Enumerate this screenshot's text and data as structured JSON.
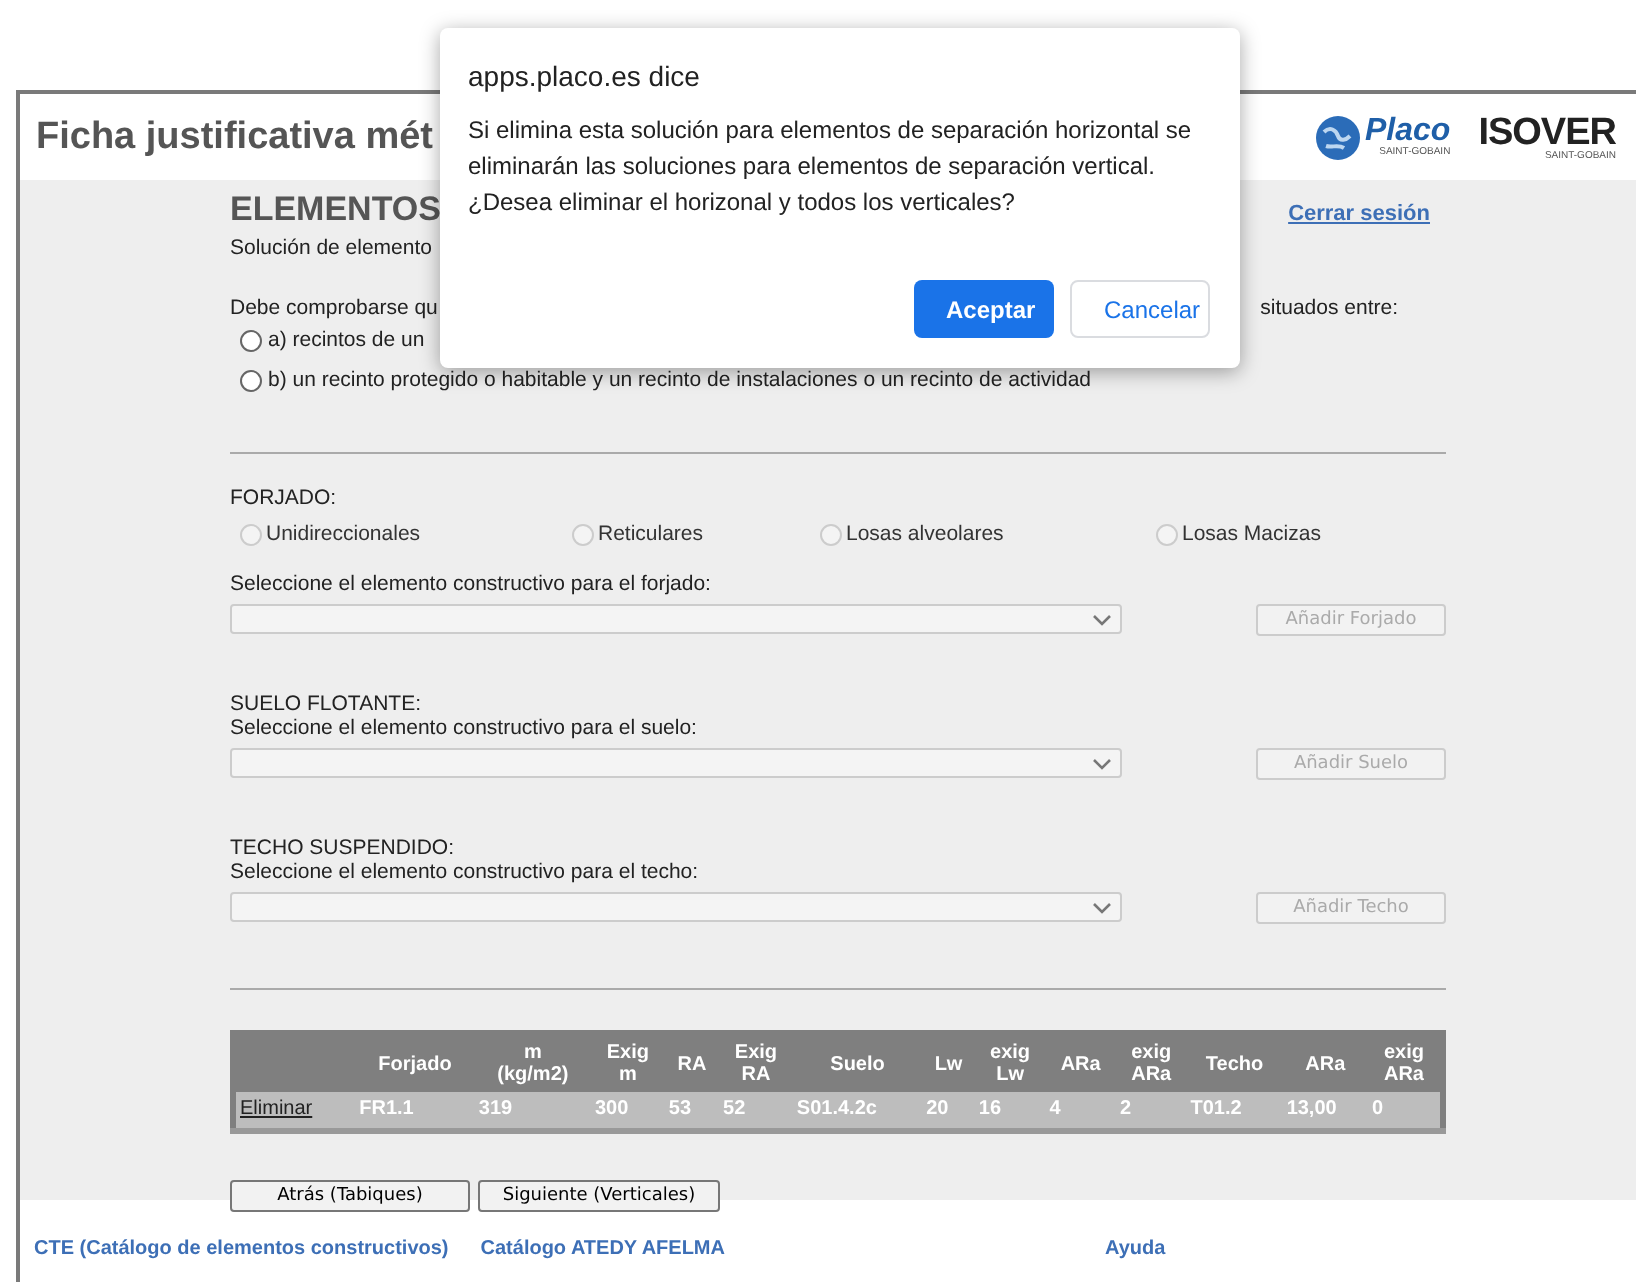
{
  "header": {
    "title": "Ficha justificativa mét",
    "logos": [
      {
        "kind": "placo",
        "name": "Placo",
        "sub": "SAINT-GOBAIN"
      },
      {
        "kind": "isover",
        "name": "ISOVER",
        "sub": "SAINT-GOBAIN"
      }
    ]
  },
  "content": {
    "heading": "ELEMENTOS",
    "logout": "Cerrar sesión",
    "subtitle": "Solución de elemento",
    "intro_left": "Debe comprobarse qu",
    "intro_right": "situados entre:",
    "options": [
      {
        "label": "a) recintos de un",
        "selected": false
      },
      {
        "label": "b) un recinto protegido o habitable y un recinto de instalaciones o un recinto de actividad",
        "selected": false
      }
    ],
    "forjado": {
      "title": "FORJADO:",
      "types": [
        {
          "label": "Unidireccionales",
          "selected": false
        },
        {
          "label": "Reticulares",
          "selected": false
        },
        {
          "label": "Losas alveolares",
          "selected": false
        },
        {
          "label": "Losas Macizas",
          "selected": false
        }
      ],
      "prompt": "Seleccione el elemento constructivo para el forjado:",
      "button": "Añadir Forjado",
      "disabled": true
    },
    "sections": [
      {
        "title": "SUELO FLOTANTE:",
        "prompt": "Seleccione el elemento constructivo para el suelo:",
        "button": "Añadir Suelo",
        "disabled": true
      },
      {
        "title": "TECHO SUSPENDIDO:",
        "prompt": "Seleccione el elemento constructivo para el techo:",
        "button": "Añadir Techo",
        "disabled": true
      }
    ],
    "table": {
      "columns": [
        "Forjado",
        "m\n(kg/m2)",
        "Exig\nm",
        "RA",
        "Exig\nRA",
        "Suelo",
        "Lw",
        "exig\nLw",
        "ARa",
        "exig\nARa",
        "Techo",
        "ARa",
        "exig\nARa"
      ],
      "rows": [
        {
          "action": "Eliminar",
          "cells": [
            "FR1.1",
            "319",
            "300",
            "53",
            "52",
            "S01.4.2c",
            "20",
            "16",
            "4",
            "2",
            "T01.2",
            "13,00",
            "0"
          ]
        }
      ]
    },
    "nav_buttons": [
      "Atrás (Tabiques)",
      "Siguiente (Verticales)"
    ]
  },
  "footer": {
    "links": [
      "CTE (Catálogo de elementos constructivos)",
      "Catálogo ATEDY AFELMA",
      "Ayuda"
    ]
  },
  "dialog": {
    "title": "apps.placo.es dice",
    "message": "Si elimina esta solución para elementos de separación horizontal se eliminarán las soluciones para elementos de separación vertical. ¿Desea eliminar el horizonal  y todos los verticales?",
    "ok": "Aceptar",
    "cancel": "Cancelar"
  }
}
